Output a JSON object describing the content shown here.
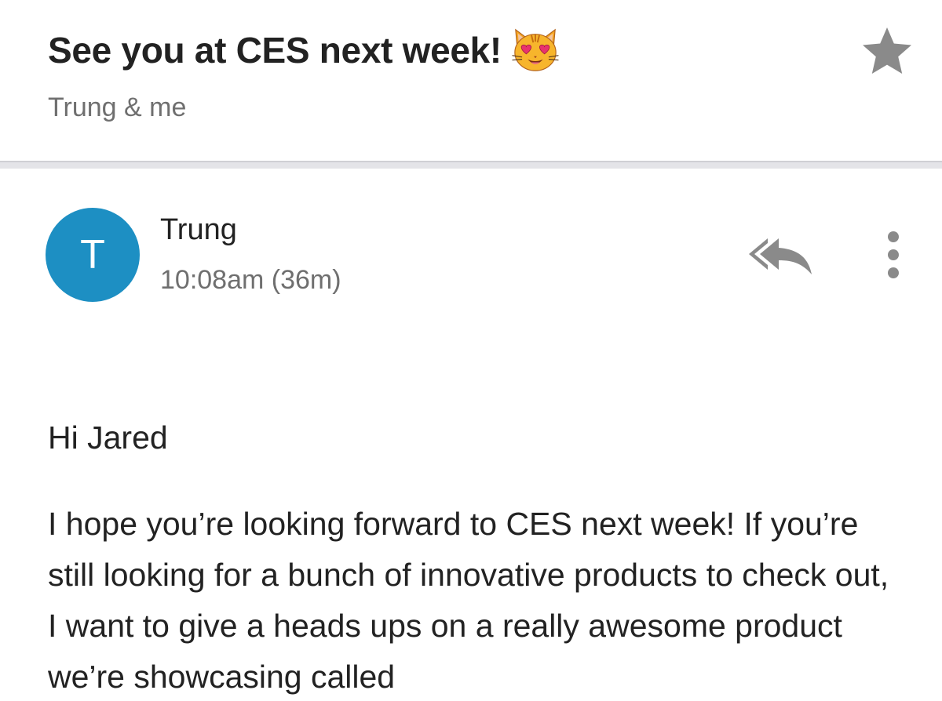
{
  "email": {
    "subject": "See you at CES next week!",
    "subject_emoji": "smiling-cat-heart-eyes-emoji",
    "participants": "Trung & me",
    "starred": false
  },
  "message": {
    "avatar_initial": "T",
    "sender": "Trung",
    "time": "10:08am (36m)",
    "greeting": "Hi Jared",
    "body": "I hope you’re looking forward to CES next week! If you’re still looking for a bunch of innovative products to check out, I want to give a heads ups on a really awesome product we’re showcasing called"
  },
  "icons": {
    "star": "star-icon",
    "reply_all": "reply-all-icon",
    "more": "more-vertical-icon"
  },
  "colors": {
    "avatar_bg": "#1d8fc3",
    "icon_gray": "#8a8a8a",
    "secondary_text": "#6f6f6f",
    "divider": "#e4e4e8"
  }
}
